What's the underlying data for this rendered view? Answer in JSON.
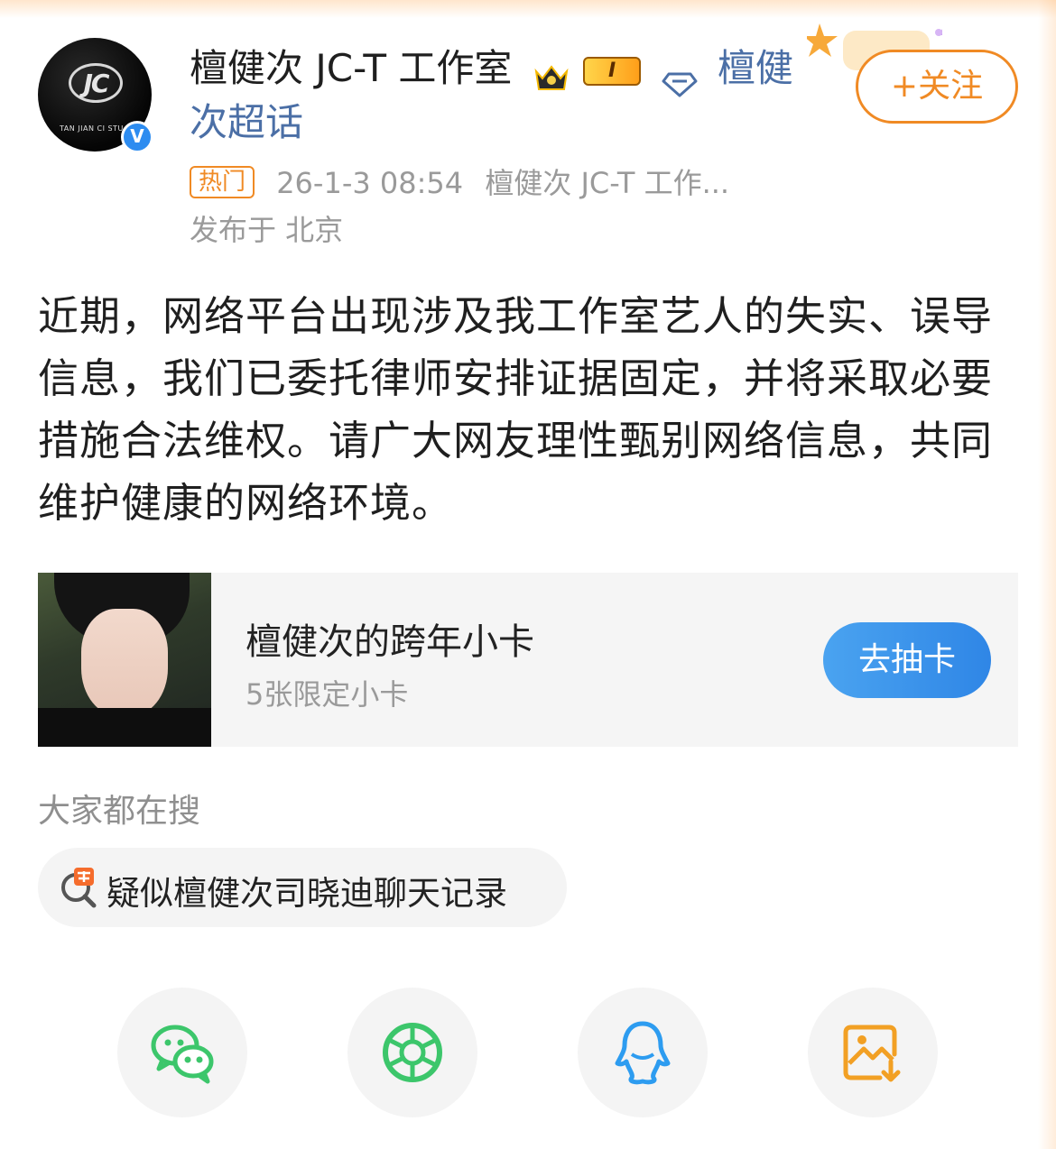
{
  "post": {
    "author_name": "檀健次 JC-T 工作室",
    "level_badge": "I",
    "super_topic": "檀健次超话",
    "hot_tag": "热门",
    "timestamp": "26-1-3 08:54",
    "source": "檀健次 JC-T 工作...",
    "location": "发布于 北京",
    "follow_label": "+关注",
    "verified_mark": "V",
    "avatar_logo": "JC",
    "avatar_caption": "TAN JIAN CI STU",
    "body": "近期，网络平台出现涉及我工作室艺人的失实、误导信息，我们已委托律师安排证据固定，并将采取必要措施合法维权。请广大网友理性甄别网络信息，共同维护健康的网络环境。"
  },
  "card": {
    "title": "檀健次的跨年小卡",
    "subtitle": "5张限定小卡",
    "button_label": "去抽卡"
  },
  "search": {
    "label": "大家都在搜",
    "items": [
      {
        "text": "疑似檀健次司晓迪聊天记录",
        "icon": "hot-search-icon"
      }
    ]
  },
  "share": {
    "buttons": [
      {
        "icon": "wechat-icon",
        "color": "#3cc66b"
      },
      {
        "icon": "moments-icon",
        "color": "#3cc66b"
      },
      {
        "icon": "qq-icon",
        "color": "#2d9cf0"
      },
      {
        "icon": "save-image-icon",
        "color": "#f2a024"
      }
    ]
  },
  "colors": {
    "accent_orange": "#f08a24",
    "super_topic_blue": "#4b6fa6",
    "button_blue": "#2f86e6"
  }
}
